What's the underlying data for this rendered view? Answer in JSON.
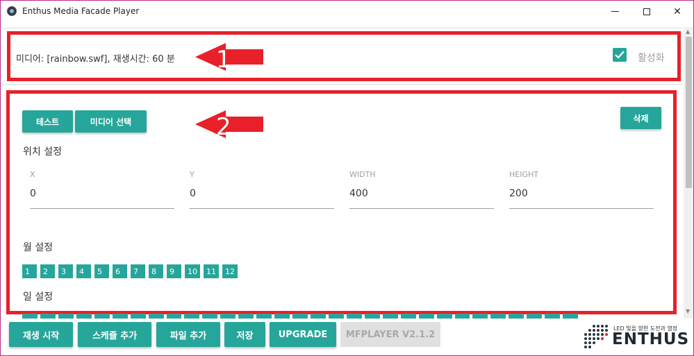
{
  "window": {
    "title": "Enthus Media Facade Player"
  },
  "media": {
    "info": "미디어: [rainbow.swf], 재생시간: 60 분",
    "activate_label": "활성화",
    "activate_checked": true
  },
  "annotations": {
    "arrow1": "1",
    "arrow2": "2"
  },
  "buttons": {
    "test": "테스트",
    "select_media": "미디어 선택",
    "delete": "삭제"
  },
  "position": {
    "title": "위치 설정",
    "x_label": "X",
    "x_value": "0",
    "y_label": "Y",
    "y_value": "0",
    "width_label": "WIDTH",
    "width_value": "400",
    "height_label": "HEIGHT",
    "height_value": "200"
  },
  "month": {
    "title": "월 설정",
    "items": [
      "1",
      "2",
      "3",
      "4",
      "5",
      "6",
      "7",
      "8",
      "9",
      "10",
      "11",
      "12"
    ]
  },
  "day": {
    "title": "일 설정"
  },
  "footer": {
    "play": "재생 시작",
    "add_schedule": "스케쥴 추가",
    "add_file": "파일 추가",
    "save": "저장",
    "upgrade": "UPGRADE",
    "version": "MFPLAYER V2.1.2"
  },
  "logo": {
    "tagline": "LED 빛을 향한 도전과 열정",
    "word": "ENTHUS"
  },
  "colors": {
    "accent": "#26a69a",
    "annotation": "#e8202a",
    "disabled": "#e0e0e0"
  }
}
